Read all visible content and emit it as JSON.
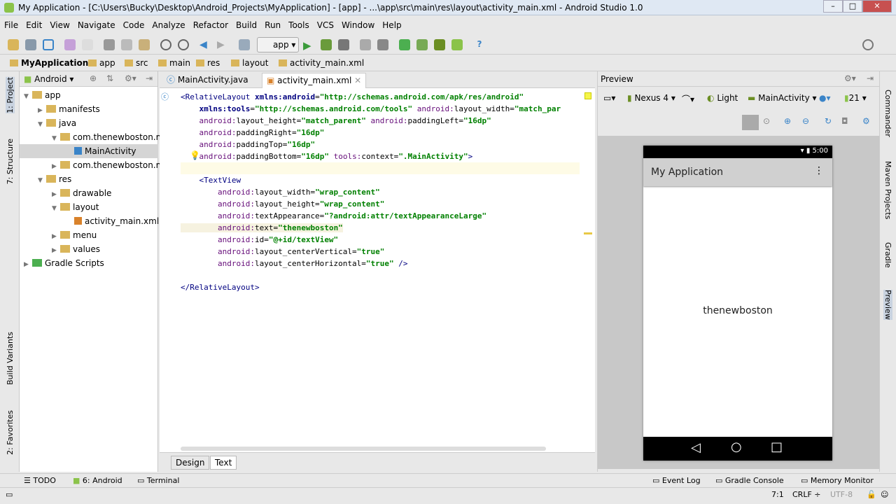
{
  "window": {
    "title": "My Application - [C:\\Users\\Bucky\\Desktop\\Android_Projects\\MyApplication] - [app] - ...\\app\\src\\main\\res\\layout\\activity_main.xml - Android Studio 1.0"
  },
  "menu": [
    "File",
    "Edit",
    "View",
    "Navigate",
    "Code",
    "Analyze",
    "Refactor",
    "Build",
    "Run",
    "Tools",
    "VCS",
    "Window",
    "Help"
  ],
  "toolbar": {
    "run_config": "app"
  },
  "breadcrumb": [
    "MyApplication",
    "app",
    "src",
    "main",
    "res",
    "layout",
    "activity_main.xml"
  ],
  "left_strip": [
    "1: Project",
    "7: Structure",
    "Build Variants",
    "2: Favorites"
  ],
  "project": {
    "view": "Android",
    "tree": [
      {
        "label": "app",
        "depth": 0,
        "open": true
      },
      {
        "label": "manifests",
        "depth": 1,
        "open": false
      },
      {
        "label": "java",
        "depth": 1,
        "open": true
      },
      {
        "label": "com.thenewboston.m",
        "depth": 2,
        "open": true
      },
      {
        "label": "MainActivity",
        "depth": 3,
        "selected": true
      },
      {
        "label": "com.thenewboston.m",
        "depth": 2,
        "open": false
      },
      {
        "label": "res",
        "depth": 1,
        "open": true
      },
      {
        "label": "drawable",
        "depth": 2,
        "open": false
      },
      {
        "label": "layout",
        "depth": 2,
        "open": true
      },
      {
        "label": "activity_main.xml",
        "depth": 3
      },
      {
        "label": "menu",
        "depth": 2,
        "open": false
      },
      {
        "label": "values",
        "depth": 2,
        "open": false
      },
      {
        "label": "Gradle Scripts",
        "depth": 0,
        "open": false
      }
    ]
  },
  "editor": {
    "tabs": [
      "MainActivity.java",
      "activity_main.xml"
    ],
    "bottom_tabs": [
      "Design",
      "Text"
    ]
  },
  "preview": {
    "title": "Preview",
    "device": "Nexus 4",
    "theme": "Light",
    "activity": "MainActivity",
    "api": "21",
    "app_title": "My Application",
    "time": "5:00",
    "text": "thenewboston"
  },
  "right_strip": [
    "Commander",
    "Maven Projects",
    "Gradle",
    "Preview"
  ],
  "bottom": {
    "left": [
      "TODO",
      "6: Android",
      "Terminal"
    ],
    "right": [
      "Event Log",
      "Gradle Console",
      "Memory Monitor"
    ]
  },
  "status": {
    "position": "7:1",
    "line_sep": "CRLF",
    "encoding": "UTF-8"
  }
}
